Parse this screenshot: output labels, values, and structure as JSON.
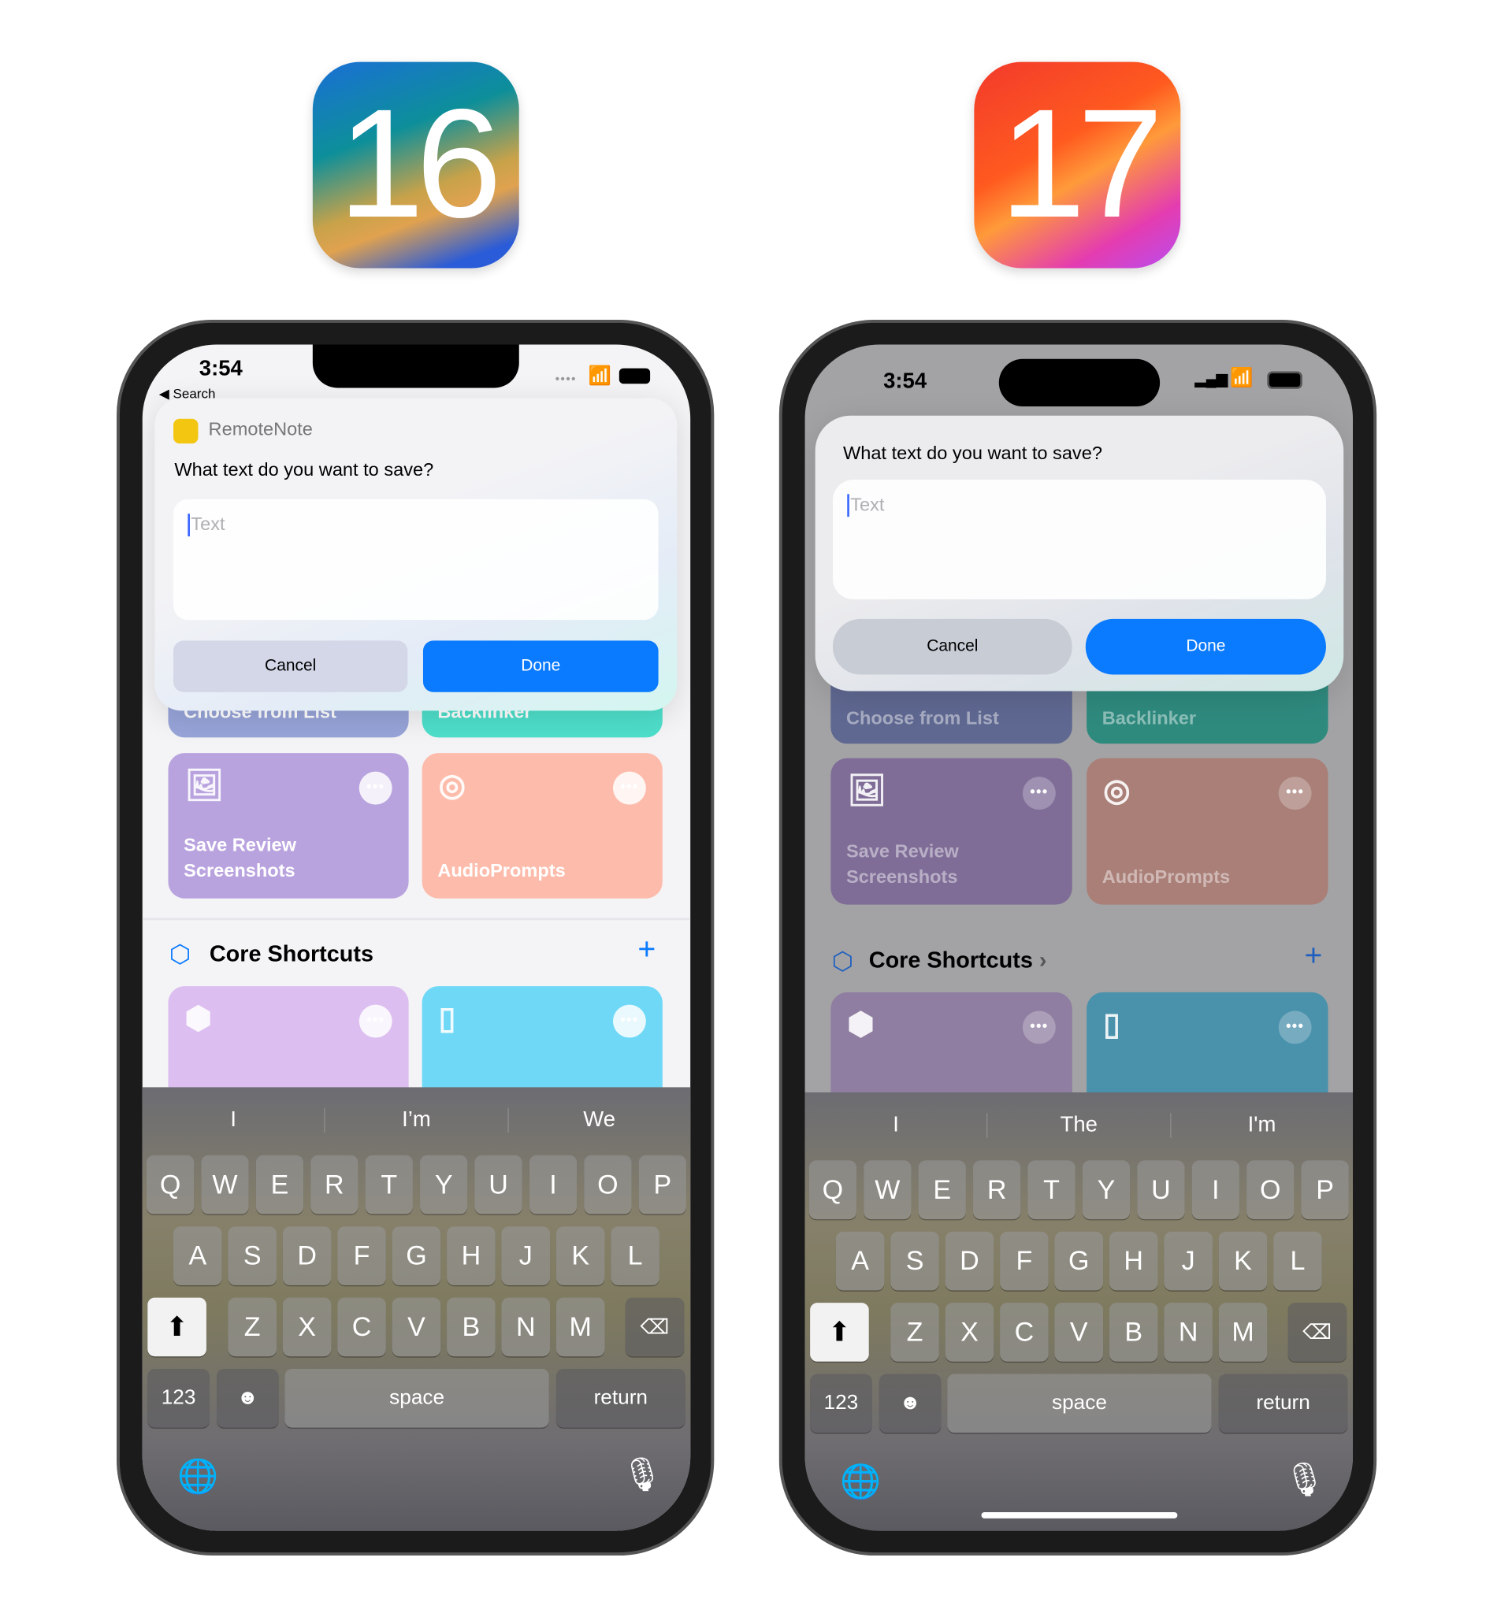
{
  "badges": {
    "left": "16",
    "right": "17"
  },
  "ios16": {
    "status": {
      "time": "3:54",
      "back": "◀ Search"
    },
    "dialog": {
      "app_name": "RemoteNote",
      "question": "What text do you want to save?",
      "placeholder": "Text",
      "cancel": "Cancel",
      "done": "Done"
    },
    "tiles": [
      {
        "label": "Choose from List",
        "color": "#97a4d8"
      },
      {
        "label": "Backlinker",
        "color": "#4edfcb"
      },
      {
        "label": "Save Review Screenshots",
        "color": "#b9a3df",
        "icon": "photos-icon"
      },
      {
        "label": "AudioPrompts",
        "color": "#fdbcab",
        "icon": "airplay-audio-icon"
      },
      {
        "label": "",
        "color": "#dcbff0",
        "icon": "cube-icon"
      },
      {
        "label": "",
        "color": "#6fd8f7",
        "icon": "remote-icon"
      }
    ],
    "section": {
      "title": "Core Shortcuts",
      "add": "+"
    },
    "keyboard": {
      "suggestions": [
        "I",
        "I’m",
        "We"
      ],
      "rows": [
        [
          "Q",
          "W",
          "E",
          "R",
          "T",
          "Y",
          "U",
          "I",
          "O",
          "P"
        ],
        [
          "A",
          "S",
          "D",
          "F",
          "G",
          "H",
          "J",
          "K",
          "L"
        ],
        [
          "Z",
          "X",
          "C",
          "V",
          "B",
          "N",
          "M"
        ]
      ],
      "numbers": "123",
      "space": "space",
      "return": "return"
    }
  },
  "ios17": {
    "status": {
      "time": "3:54"
    },
    "dialog": {
      "question": "What text do you want to save?",
      "placeholder": "Text",
      "cancel": "Cancel",
      "done": "Done"
    },
    "tiles": [
      {
        "label": "Choose from List",
        "color": "#5f6891"
      },
      {
        "label": "Backlinker",
        "color": "#2f8a7e"
      },
      {
        "label": "Save Review Screenshots",
        "color": "#7f6d97",
        "icon": "photos-icon"
      },
      {
        "label": "AudioPrompts",
        "color": "#a97f78",
        "icon": "airplay-audio-icon"
      },
      {
        "label": "",
        "color": "#8f7ea1",
        "icon": "cube-icon"
      },
      {
        "label": "",
        "color": "#4a91ab",
        "icon": "remote-icon"
      }
    ],
    "section": {
      "title": "Core Shortcuts",
      "chevron": "›",
      "add": "+"
    },
    "keyboard": {
      "suggestions": [
        "I",
        "The",
        "I'm"
      ],
      "rows": [
        [
          "Q",
          "W",
          "E",
          "R",
          "T",
          "Y",
          "U",
          "I",
          "O",
          "P"
        ],
        [
          "A",
          "S",
          "D",
          "F",
          "G",
          "H",
          "J",
          "K",
          "L"
        ],
        [
          "Z",
          "X",
          "C",
          "V",
          "B",
          "N",
          "M"
        ]
      ],
      "numbers": "123",
      "space": "space",
      "return": "return"
    }
  }
}
